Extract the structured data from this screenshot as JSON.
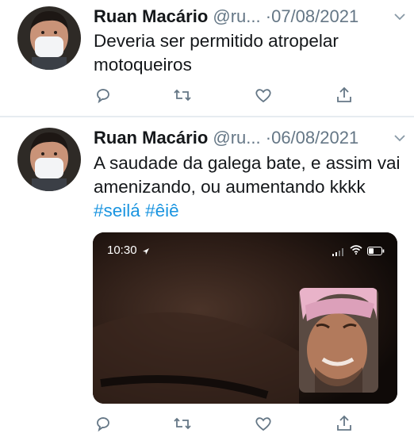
{
  "tweets": [
    {
      "name": "Ruan Macário",
      "handle": "@ru...",
      "separator": "·",
      "date": "07/08/2021",
      "text": "Deveria ser permitido atropelar motoqueiros"
    },
    {
      "name": "Ruan Macário",
      "handle": "@ru...",
      "separator": "·",
      "date": "06/08/2021",
      "text_plain": "A saudade da galega bate, e assim vai amenizando, ou aumentando kkkk ",
      "hashtags": [
        "#seilá",
        "#êiê"
      ],
      "media": {
        "status_time": "10:30",
        "content": "video call screenshot"
      }
    }
  ],
  "icons": [
    "reply-icon",
    "retweet-icon",
    "like-icon",
    "share-icon",
    "chevron-down-icon"
  ],
  "colors": {
    "hashtag": "#1b95e0",
    "meta": "#657786",
    "divider": "#e6ecf0",
    "icon": "#657786"
  }
}
